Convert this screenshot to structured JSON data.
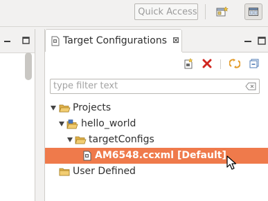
{
  "toolbar": {
    "quick_access_placeholder": "Quick Access"
  },
  "view": {
    "title": "Target Configurations",
    "close_glyph": "⊠",
    "filter_placeholder": "type filter text"
  },
  "tree": {
    "projects_label": "Projects",
    "hello_world_label": "hello_world",
    "target_configs_label": "targetConfigs",
    "selected_file_label": "AM6548.ccxml [Default]",
    "user_defined_label": "User Defined"
  },
  "colors": {
    "selection": "#ef7a4b",
    "folder": "#e0b04a",
    "delete": "#d0261f"
  }
}
